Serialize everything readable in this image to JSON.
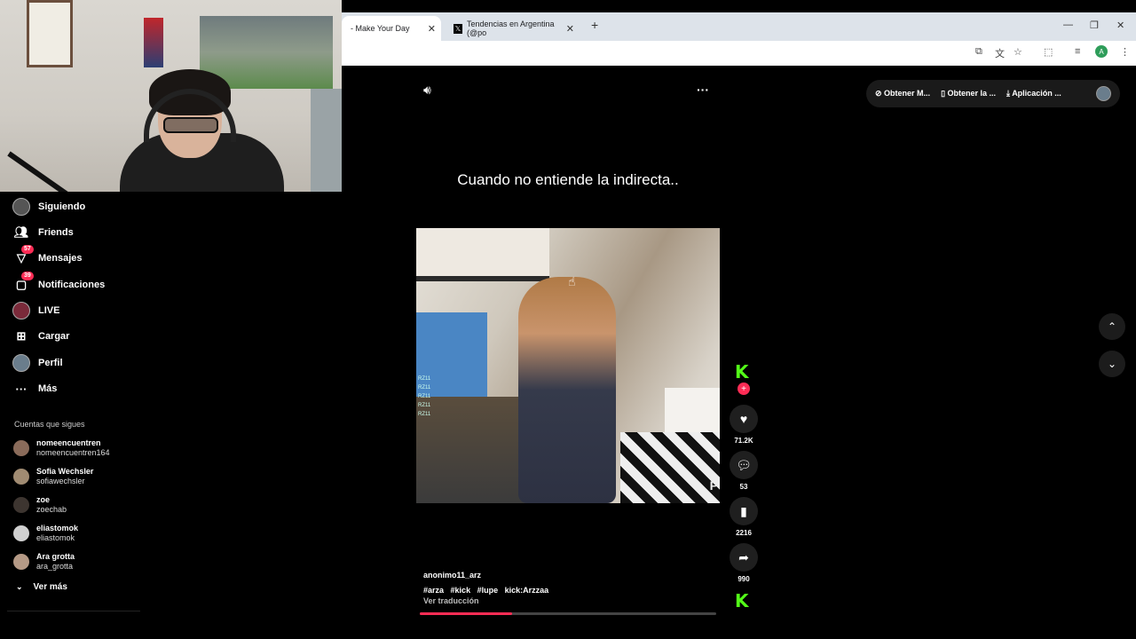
{
  "browser": {
    "tabs": [
      {
        "title": "- Make Your Day",
        "close": "✕"
      },
      {
        "title": "Tendencias en Argentina (@po",
        "close": "✕"
      }
    ],
    "new_tab": "+",
    "profile_initial": "A"
  },
  "nav": {
    "items": [
      {
        "label": "Siguiendo",
        "icon": "following-avatar-icon"
      },
      {
        "label": "Friends",
        "icon": "friends-icon"
      },
      {
        "label": "Mensajes",
        "icon": "messages-icon",
        "badge": "57"
      },
      {
        "label": "Notificaciones",
        "icon": "notifications-icon",
        "badge": "39"
      },
      {
        "label": "LIVE",
        "icon": "live-icon"
      },
      {
        "label": "Cargar",
        "icon": "upload-icon"
      },
      {
        "label": "Perfil",
        "icon": "profile-icon"
      },
      {
        "label": "Más",
        "icon": "more-icon"
      }
    ]
  },
  "following": {
    "title": "Cuentas que sigues",
    "accounts": [
      {
        "name": "nomeencuentren",
        "handle": "nomeencuentren164",
        "color": "#8a6b5a"
      },
      {
        "name": "Sofia Wechsler",
        "handle": "sofiawechsler",
        "color": "#a08b72"
      },
      {
        "name": "zoe",
        "handle": "zoechab",
        "color": "#3d3530"
      },
      {
        "name": "eliastomok",
        "handle": "eliastomok",
        "color": "#d0d0d0"
      },
      {
        "name": "Ara grotta",
        "handle": "ara_grotta",
        "color": "#b59a86"
      }
    ],
    "more_label": "Ver más"
  },
  "video": {
    "caption": "Cuando no entiende la indirecta..",
    "author": "anonimo11_arz",
    "tags": [
      "#arza",
      "#kick",
      "#lupe",
      "kick:Arzzaa"
    ],
    "translate": "Ver traducción",
    "watermark": "P",
    "progress": 0.31,
    "chat_lines": [
      "RZ11",
      "RZ11",
      "RZ11",
      "RZ11",
      "RZ11"
    ]
  },
  "actions": {
    "likes": "71.2K",
    "comments": "53",
    "saves": "2216",
    "shares": "990"
  },
  "topbar": {
    "pills": [
      "Obtener M...",
      "Obtener la ...",
      "Aplicación ..."
    ]
  },
  "colors": {
    "accent": "#fe2c55",
    "kick": "#53fc18"
  }
}
